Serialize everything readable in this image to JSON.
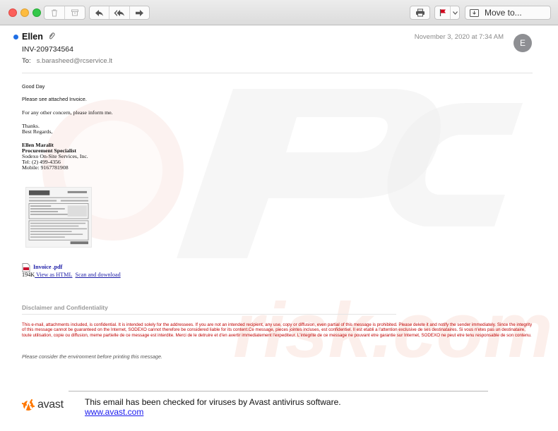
{
  "toolbar": {
    "move_to_label": "Move to..."
  },
  "message": {
    "sender": "Ellen",
    "date": "November 3, 2020 at 7:34 AM",
    "avatar_initial": "E",
    "subject": "INV-209734564",
    "to_label": "To:",
    "to_address": "s.barasheed@rcservice.lt"
  },
  "body": {
    "greeting": "Good Day",
    "line1": "Please see attached Invoice.",
    "line2": "For any other concern, please inform me.",
    "thanks": "Thanks.",
    "regards": "Best Regards,",
    "sig_name": "Ellen Maralit",
    "sig_title": "Procurement Specialist",
    "sig_company": "Sodexo On-Site Services, Inc.",
    "sig_tel": "Tel:  (2) 499-4356",
    "sig_mobile": "Mobile:  9167781908"
  },
  "attachment": {
    "name": "Invoice .pdf",
    "size": "194K",
    "view_link": " View as HTML",
    "download_link": "Scan and download"
  },
  "disclaimer": {
    "title": "Disclaimer and Confidentiality",
    "text": "This e-mail, attachments included, is confidential. It is intended solely for the addressees. If you are not an intended recipient, any use, copy or diffusion, even partial of this message is prohibited. Please delete it and notify the sender immediately. Since the integrity of this message cannot be guaranteed on the Internet, SODEXO cannot therefore be considered liable for its content.Ce message, pieces jointes incluses, est confidentiel. Il est etabli a l'attention exclusive de ses destinataires. Si vous n'etes pas un destinataire, toute utilisation, copie ou diffusion, meme partielle de ce message est interdite. Merci de le detruire et d'en avertir immediatement l'expediteur. L'integrite de ce message ne pouvant etre garantie sur Internet, SODEXO ne peut etre tenu responsable de son contenu.",
    "environment_note": "Please consider the environment before printing this message."
  },
  "avast": {
    "logo_word": "avast",
    "checked_text": "This email has been checked for viruses by Avast antivirus software.",
    "link": "www.avast.com"
  },
  "colors": {
    "unread_dot": "#1f6fe5",
    "disclaimer_red": "#c00000",
    "link_blue": "#1a1aa6",
    "avast_orange": "#ff7800",
    "flag_red": "#d0021b"
  },
  "icons": [
    "trash-icon",
    "archive-icon",
    "reply-icon",
    "reply-all-icon",
    "forward-icon",
    "print-icon",
    "flag-icon",
    "chevron-down-icon",
    "move-to-icon",
    "paperclip-icon",
    "pdf-icon",
    "avast-logo-icon"
  ]
}
